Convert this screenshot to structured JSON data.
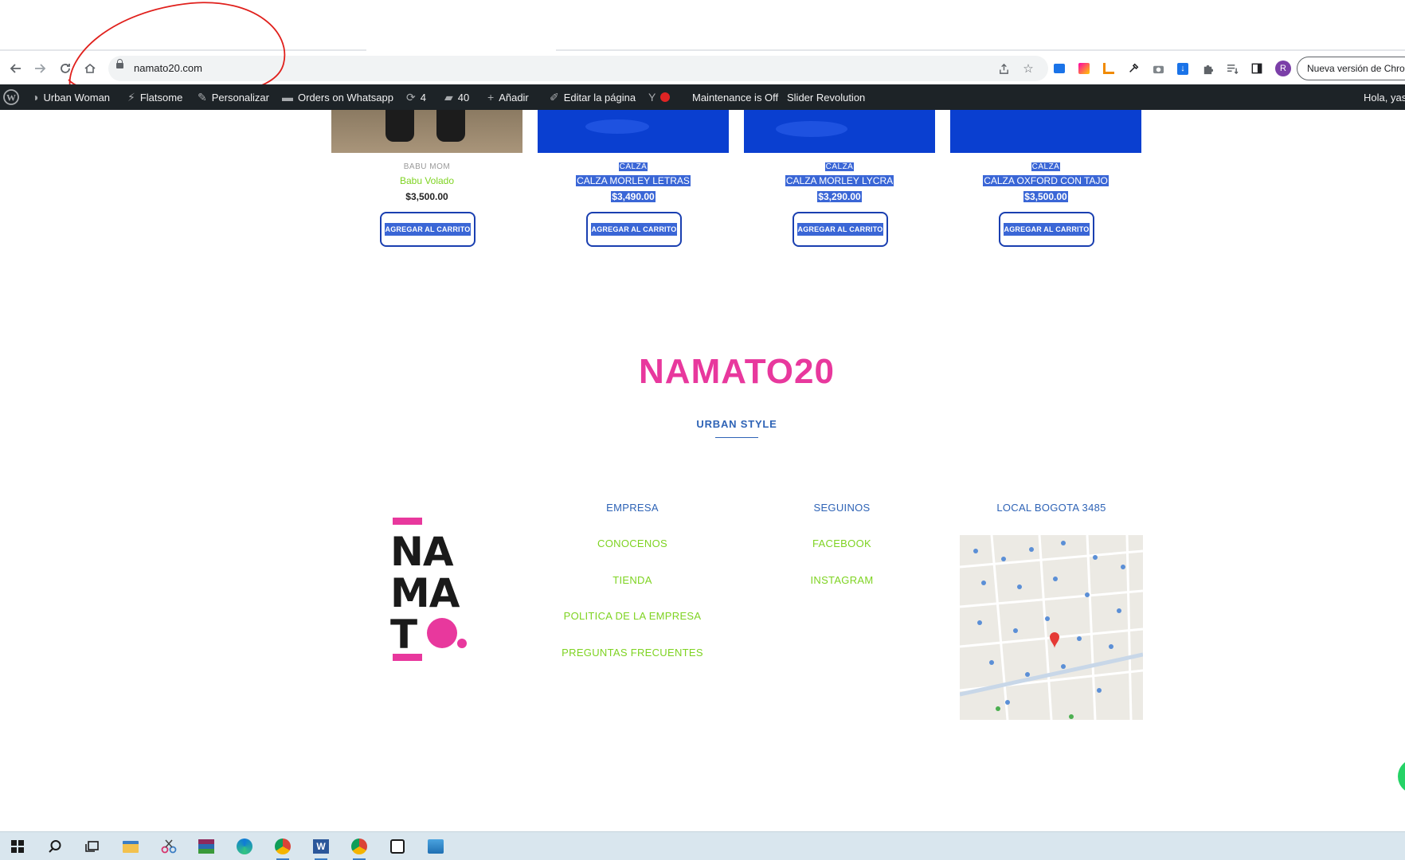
{
  "browser": {
    "url": "namato20.com",
    "update_button": "Nueva versión de Chrome",
    "profile_initial": "R"
  },
  "wp_admin_bar": {
    "site_name": "Urban Woman",
    "theme": "Flatsome",
    "customize": "Personalizar",
    "orders": "Orders on Whatsapp",
    "updates_count": "4",
    "comments_count": "40",
    "add_new": "Añadir",
    "edit_page": "Editar la página",
    "maintenance": "Maintenance is Off",
    "slider": "Slider Revolution",
    "greeting": "Hola, yasl"
  },
  "products": [
    {
      "category": "BABU MOM",
      "name": "Babu Volado",
      "price": "$3,500.00",
      "button": "AGREGAR AL CARRITO",
      "selected": false
    },
    {
      "category": "CALZA",
      "name": "CALZA MORLEY LETRAS",
      "price": "$3,490.00",
      "button": "AGREGAR AL CARRITO",
      "selected": true
    },
    {
      "category": "CALZA",
      "name": "CALZA MORLEY LYCRA",
      "price": "$3,290.00",
      "button": "AGREGAR AL CARRITO",
      "selected": true
    },
    {
      "category": "CALZA",
      "name": "CALZA OXFORD CON TAJO",
      "price": "$3,500.00",
      "button": "AGREGAR AL CARRITO",
      "selected": true
    }
  ],
  "brand": {
    "name": "NAMATO20",
    "slogan": "URBAN STYLE",
    "logo_lines": [
      "NA",
      "MA",
      "T"
    ]
  },
  "footer": {
    "company": {
      "heading": "EMPRESA",
      "links": [
        "CONOCENOS",
        "TIENDA",
        "POLITICA DE LA EMPRESA",
        "PREGUNTAS FRECUENTES"
      ]
    },
    "social": {
      "heading": "SEGUINOS",
      "links": [
        "FACEBOOK",
        "INSTAGRAM"
      ]
    },
    "location": {
      "heading": "LOCAL BOGOTA 3485"
    }
  },
  "colors": {
    "brand_pink": "#e8389d",
    "link_blue": "#2e63b6",
    "link_green": "#7ed321",
    "product_blue": "#0a3fd0",
    "admin_bar": "#1d2327"
  }
}
